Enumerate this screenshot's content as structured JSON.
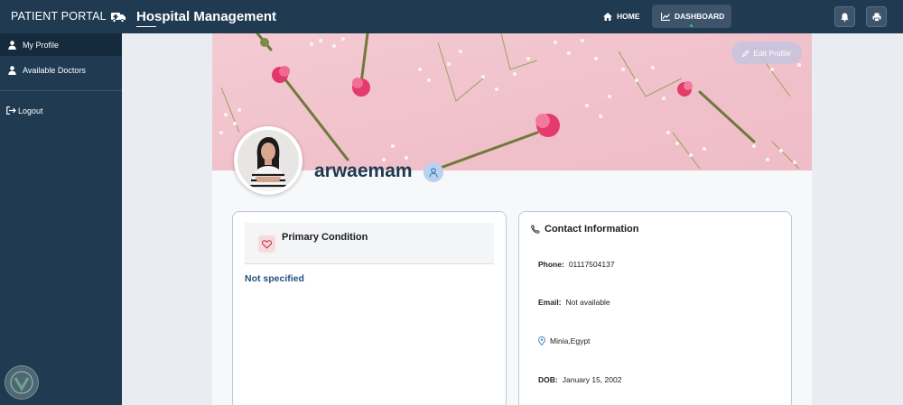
{
  "topbar": {
    "brand": "PATIENT PORTAL",
    "title": "Hospital Management",
    "nav_home": "HOME",
    "nav_dashboard": "DASHBOARD"
  },
  "sidebar": {
    "items": [
      {
        "label": "My Profile",
        "icon": "user-icon",
        "active": true
      },
      {
        "label": "Available Doctors",
        "icon": "user-icon",
        "active": false
      }
    ],
    "logout": "Logout"
  },
  "profile": {
    "edit_label": "Edit Profile",
    "username": "arwaemam"
  },
  "condition": {
    "title": "Primary Condition",
    "value": "Not specified"
  },
  "contact": {
    "title": "Contact Information",
    "phone_label": "Phone:",
    "phone": "01117504137",
    "email_label": "Email:",
    "email": "Not available",
    "location": "Minia,Egypt",
    "dob_label": "DOB:",
    "dob": "January 15, 2002"
  },
  "colors": {
    "nav": "#203a52",
    "accent_text": "#24527f",
    "cover_pink": "#f3c6cf"
  }
}
